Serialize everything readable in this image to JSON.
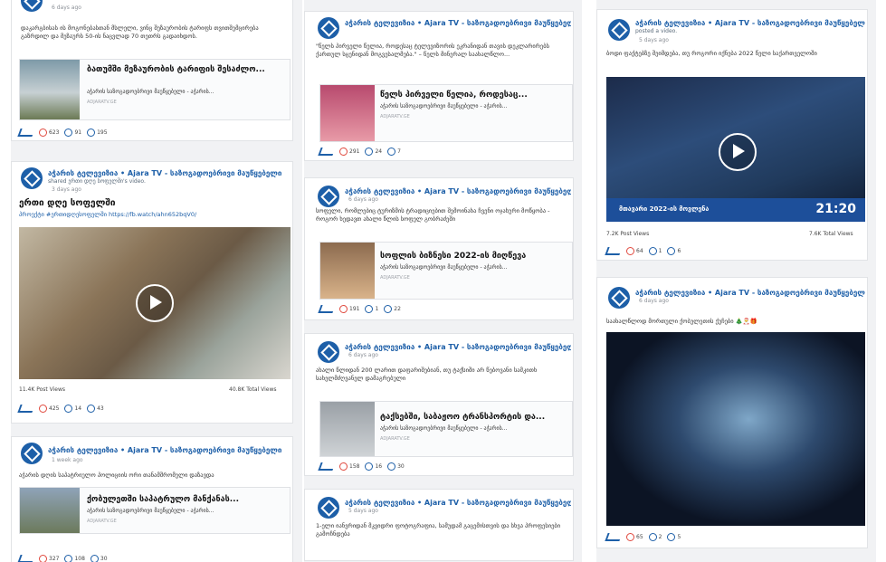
{
  "common": {
    "page_name": "აჭარის ტელევიზია • Ajara TV - საზოგადოებრივი მაუწყებელი",
    "link_source": "აჭარის საზოგადოებრივი მაუწყებელი - აჭარის...",
    "link_domain": "ADJARATV.GE",
    "shared_video": "shared ერთი დღე სოფელში's video.",
    "posted_video": "posted a video."
  },
  "col1": {
    "p0": {
      "time": "6 days ago",
      "text": "დაკარგბისას ის მოგონებასთან მსლელი, ვინც შეზაურობის ტარიფს თვითშემცირება გაზრდილ და მეზაურს 50-ის ნაცვლად 70 თეთრს გადაიხდოს.",
      "link_title": "ბათუმში მეზაურობის ტარიფის შესაძლო...",
      "reactions": "623",
      "comments": "91",
      "shares": "195"
    },
    "p1": {
      "time": "3 days ago",
      "title": "ერთი დღე სოფელში",
      "tags": "პროექტი #ერთიდღესოფელში https://fb.watch/ahn652bqV0/",
      "post_views": "11.4K Post Views",
      "total_views": "40.8K Total Views",
      "reactions": "425",
      "comments": "14",
      "shares": "43"
    },
    "p2": {
      "time": "1 week ago",
      "text": "აჭარის დღის საპატრიულო პოლიციის ორი თანამშრომელი დაზავდა",
      "link_title": "ქობულეთში საპატრულო მანქანას...",
      "reactions": "327",
      "comments": "108",
      "shares": "30"
    }
  },
  "col2": {
    "p0": {
      "text": "\"წელს პირველი წელია, როდესაც ტელევიზორის ეკრანიდან თავის დეკლარირებს ქართულ სცენიდან მოგვესალმება.\" – წელს მინერალ საახალწლო...",
      "link_title": "წელს პირველი წელია, როდესაც...",
      "reactions": "291",
      "comments": "24",
      "shares": "7"
    },
    "p1": {
      "time": "6 days ago",
      "text": "სოფელი, რომლებიც ტურიზმის ტრადიციებით შემოინახა ჩვენი ოჯახური მოწყობა - როგორ ხედავთ ახალი წლის სოფელ გობრაძეში",
      "link_title": "სოფლის ბიზნესი 2022-ის მიღწევა",
      "reactions": "191",
      "comments": "1",
      "shares": "22"
    },
    "p2": {
      "time": "6 days ago",
      "text": "ახალი წლიდან 200 ლარით დაფარიშებიან, თუ ტაქსიში არ წებოვანი სამკითხ სახელმძღვანელ დამაგრებული",
      "link_title": "ტაქსებში, საბაჟოო ტრანსპორტის და...",
      "reactions": "158",
      "comments": "16",
      "shares": "30"
    },
    "p3": {
      "time": "5 days ago",
      "text": "1-ელი იანვრიდან მკვიდრი ფოტოგრაფია, სამუდამ გაცემისთვის და სხვა პროფესიები გამოჩნდება"
    }
  },
  "col3": {
    "p0": {
      "time": "5 days ago",
      "text": "ბოდი ფაქტებზე შეიმდება, თუ როგორი იქნება 2022 წელი საქართველოში",
      "banner": "მთავარი 2022-ის მოვლენა",
      "clock": "21:20",
      "post_views": "7.2K Post Views",
      "total_views": "7.6K Total Views",
      "reactions": "64",
      "comments": "1",
      "shares": "6"
    },
    "p1": {
      "time": "6 days ago",
      "text": "საახალწლოდ მორთული ქობულეთის ქუჩები 🎄🎅🎁",
      "reactions": "65",
      "comments": "2",
      "shares": "5"
    }
  }
}
